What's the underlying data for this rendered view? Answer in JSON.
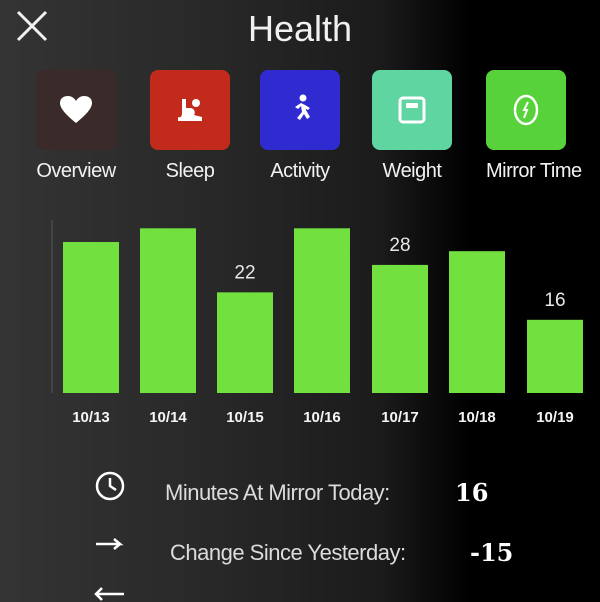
{
  "header": {
    "title": "Health",
    "close_icon": "close-icon"
  },
  "tabs": [
    {
      "label": "Overview",
      "icon": "heart-icon",
      "color": "#3b2a2a"
    },
    {
      "label": "Sleep",
      "icon": "sleep-icon",
      "color": "#c22a1c"
    },
    {
      "label": "Activity",
      "icon": "running-icon",
      "color": "#2f2bd1"
    },
    {
      "label": "Weight",
      "icon": "scale-icon",
      "color": "#5fd6a2"
    },
    {
      "label": "Mirror Time",
      "icon": "mirror-icon",
      "color": "#58d23a"
    }
  ],
  "chart_data": {
    "type": "bar",
    "categories": [
      "10/13",
      "10/14",
      "10/15",
      "10/16",
      "10/17",
      "10/18",
      "10/19"
    ],
    "values": [
      33,
      36,
      22,
      36,
      28,
      31,
      16
    ],
    "data_labels": [
      "",
      "",
      "22",
      "",
      "28",
      "",
      "16"
    ],
    "ylim": [
      0,
      40
    ],
    "bar_color": "#72e13f"
  },
  "stats": {
    "minutes_label": "Minutes At Mirror Today:",
    "minutes_value": "16",
    "change_label": "Change Since Yesterday:",
    "change_value": "-15"
  }
}
